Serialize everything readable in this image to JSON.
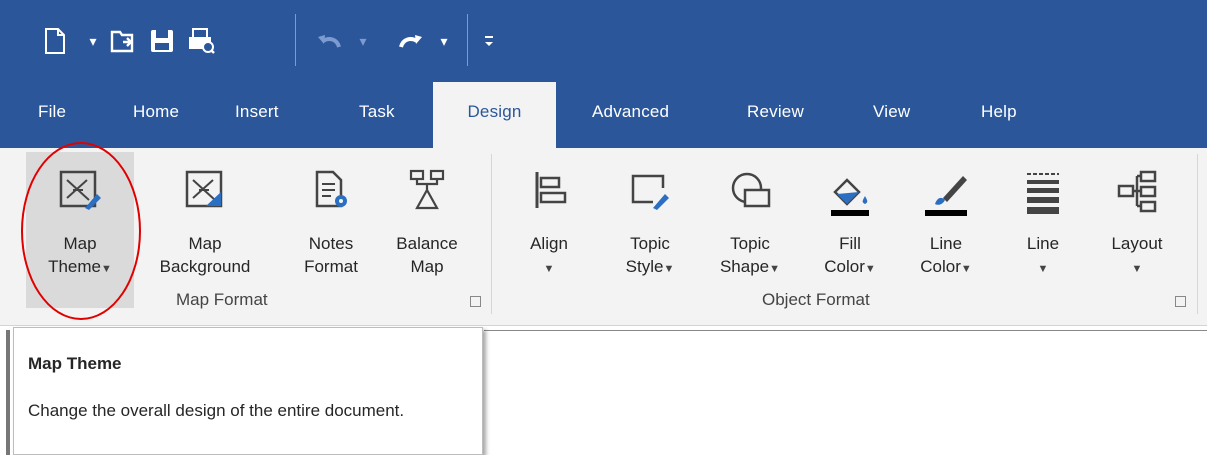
{
  "colors": {
    "title_bar": "#2b579a",
    "ribbon_bg": "#f3f3f3",
    "highlight_ring": "#e00000",
    "text": "#262626"
  },
  "quick_access": {
    "icons": [
      "new-document-icon",
      "open-file-icon",
      "save-icon",
      "print-preview-icon",
      "undo-icon",
      "redo-icon",
      "customize-qat-icon"
    ],
    "dropdown_glyph": "▾",
    "customize_glyph": "▾"
  },
  "tabs": [
    "File",
    "Home",
    "Insert",
    "Task",
    "Design",
    "Advanced",
    "Review",
    "View",
    "Help"
  ],
  "active_tab": "Design",
  "ribbon": {
    "map_format": {
      "label": "Map Format",
      "buttons": {
        "map_theme": {
          "line1": "Map",
          "line2": "Theme",
          "has_dropdown": true,
          "icon": "map-theme-icon"
        },
        "map_background": {
          "line1": "Map",
          "line2": "Background",
          "icon": "map-background-icon"
        },
        "notes_format": {
          "line1": "Notes",
          "line2": "Format",
          "icon": "notes-format-icon"
        },
        "balance_map": {
          "line1": "Balance",
          "line2": "Map",
          "icon": "balance-map-icon"
        }
      }
    },
    "object_format": {
      "label": "Object Format",
      "buttons": {
        "align": {
          "line1": "Align",
          "line2": "",
          "has_dropdown": true,
          "icon": "align-icon"
        },
        "topic_style": {
          "line1": "Topic",
          "line2": "Style",
          "has_dropdown": true,
          "icon": "topic-style-icon"
        },
        "topic_shape": {
          "line1": "Topic",
          "line2": "Shape",
          "has_dropdown": true,
          "icon": "topic-shape-icon"
        },
        "fill_color": {
          "line1": "Fill",
          "line2": "Color",
          "has_dropdown": true,
          "icon": "fill-color-icon"
        },
        "line_color": {
          "line1": "Line",
          "line2": "Color",
          "has_dropdown": true,
          "icon": "line-color-icon"
        },
        "line": {
          "line1": "Line",
          "line2": "",
          "has_dropdown": true,
          "icon": "line-style-icon"
        },
        "layout": {
          "line1": "Layout",
          "line2": "",
          "has_dropdown": true,
          "icon": "layout-icon"
        }
      }
    }
  },
  "tooltip": {
    "title": "Map Theme",
    "body": "Change the overall design of the entire document."
  }
}
